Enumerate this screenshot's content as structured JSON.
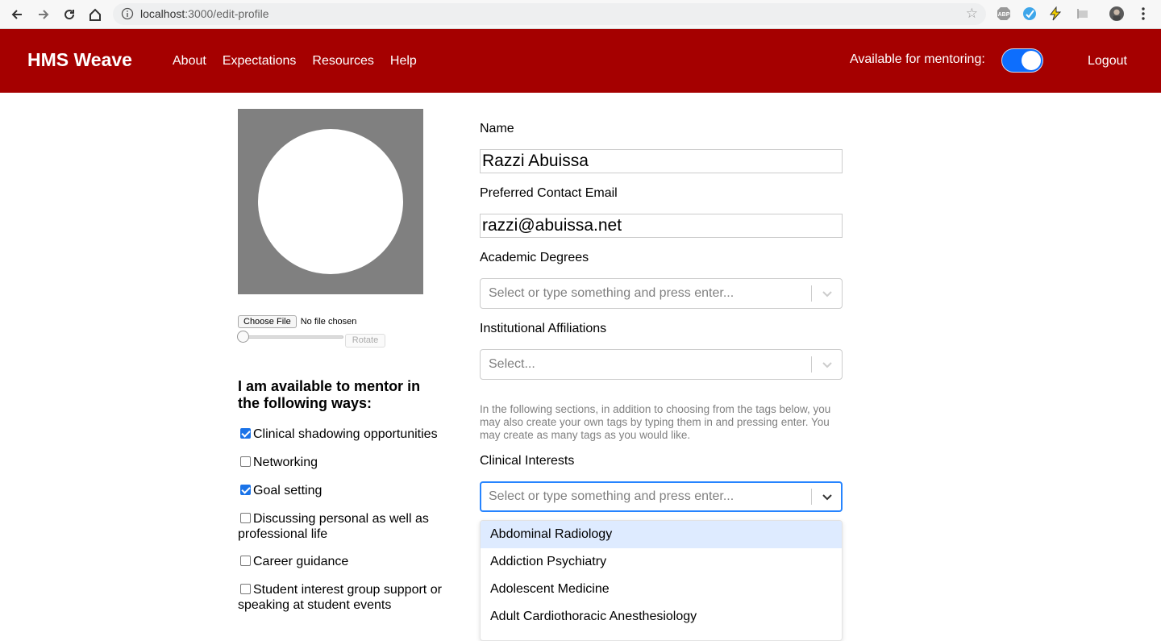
{
  "browser": {
    "url_host": "localhost",
    "url_path": ":3000/edit-profile"
  },
  "header": {
    "brand": "HMS Weave",
    "nav": [
      "About",
      "Expectations",
      "Resources",
      "Help"
    ],
    "availability_label": "Available for mentoring:",
    "availability_on": true,
    "logout": "Logout"
  },
  "photo": {
    "choose_file": "Choose File",
    "no_file": "No file chosen",
    "rotate": "Rotate"
  },
  "mentoring": {
    "title": "I am available to mentor in the following ways:",
    "options": [
      {
        "label": "Clinical shadowing opportunities",
        "checked": true
      },
      {
        "label": "Networking",
        "checked": false
      },
      {
        "label": "Goal setting",
        "checked": true
      },
      {
        "label": "Discussing personal as well as professional life",
        "checked": false
      },
      {
        "label": "Career guidance",
        "checked": false
      },
      {
        "label": "Student interest group support or speaking at student events",
        "checked": false
      }
    ]
  },
  "form": {
    "name_label": "Name",
    "name_value": "Razzi Abuissa",
    "email_label": "Preferred Contact Email",
    "email_value": "razzi@abuissa.net",
    "degrees_label": "Academic Degrees",
    "degrees_placeholder": "Select or type something and press enter...",
    "affiliations_label": "Institutional Affiliations",
    "affiliations_placeholder": "Select...",
    "helper_text": "In the following sections, in addition to choosing from the tags below, you may also create your own tags by typing them in and pressing enter. You may create as many tags as you would like.",
    "clinical_label": "Clinical Interests",
    "clinical_placeholder": "Select or type something and press enter...",
    "clinical_options": [
      "Abdominal Radiology",
      "Addiction Psychiatry",
      "Adolescent Medicine",
      "Adult Cardiothoracic Anesthesiology"
    ]
  },
  "colors": {
    "header_bg": "#a50000",
    "toggle_on": "#0d6efd",
    "focus_border": "#2684ff",
    "option_highlight": "#deebff"
  }
}
